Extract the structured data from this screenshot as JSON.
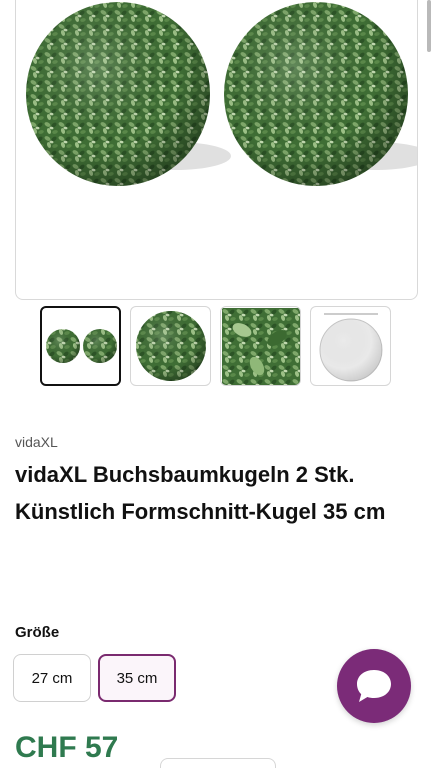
{
  "product": {
    "brand": "vidaXL",
    "title": "vidaXL Buchsbaumkugeln 2 Stk. Künstlich Formschnitt-Kugel 35 cm",
    "price": "CHF 57"
  },
  "gallery": {
    "main_image": "two-boxwood-balls-photo",
    "thumbnails": [
      {
        "image": "two-balls-thumbnail",
        "selected": true
      },
      {
        "image": "single-ball-thumbnail",
        "selected": false
      },
      {
        "image": "leaf-closeup-thumbnail",
        "selected": false
      },
      {
        "image": "dimension-diagram-thumbnail",
        "selected": false
      }
    ]
  },
  "size_selector": {
    "label": "Größe",
    "options": [
      {
        "label": "27 cm",
        "selected": false
      },
      {
        "label": "35 cm",
        "selected": true
      }
    ]
  },
  "chat": {
    "icon": "chat-bubble-icon"
  },
  "colors": {
    "price_green": "#2f7a4f",
    "accent_purple": "#7b2b78",
    "selected_border": "#7a2a6f"
  }
}
